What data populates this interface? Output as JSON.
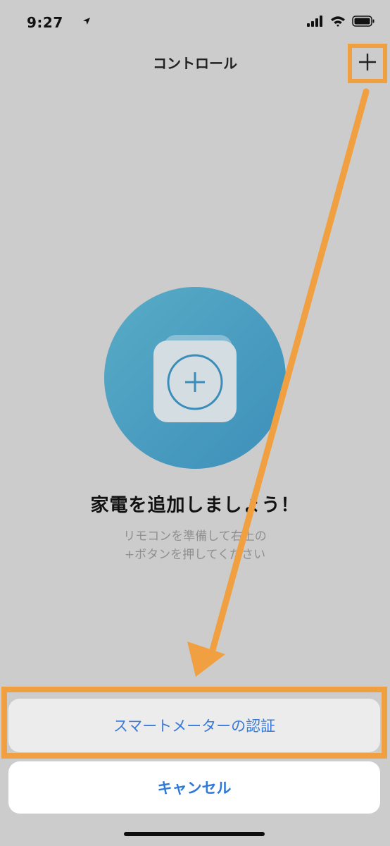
{
  "status_bar": {
    "time": "9:27",
    "icons": [
      "location-arrow-icon",
      "signal-icon",
      "wifi-icon",
      "battery-icon"
    ]
  },
  "nav": {
    "title": "コントロール",
    "add_label": "+",
    "add_icon": "plus-icon"
  },
  "empty_state": {
    "illustration_icon": "add-device-icon",
    "title": "家電を追加しましょう！",
    "description_line1": "リモコンを準備して右上の",
    "description_line2": "+ボタンを押してください"
  },
  "action_sheet": {
    "primary_label": "スマートメーターの認証",
    "cancel_label": "キャンセル"
  },
  "annotations": {
    "highlight_color": "#f0a040",
    "arrow_icon": "arrow-icon"
  },
  "colors": {
    "background": "#cccccc",
    "accent": "#3a7ad6",
    "illustration": "#4a9cc2"
  }
}
